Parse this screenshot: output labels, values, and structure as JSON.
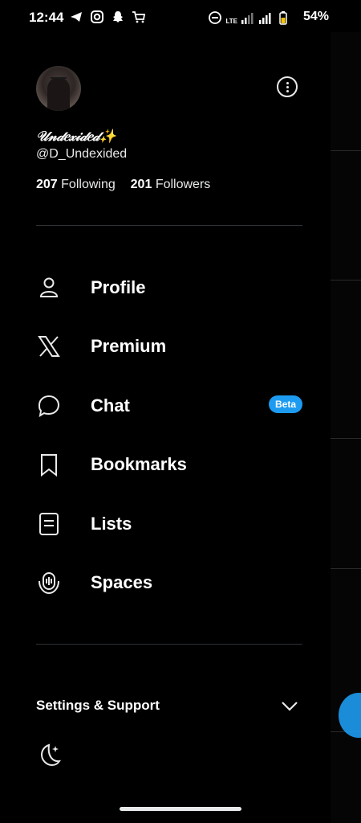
{
  "status_bar": {
    "time": "12:44",
    "battery": "54%",
    "network": "LTE",
    "icons": [
      "telegram-icon",
      "instagram-icon",
      "snapchat-icon",
      "shopping-cart-icon",
      "do-not-disturb-icon",
      "signal-icon",
      "battery-icon"
    ]
  },
  "profile": {
    "display_name": "𝒰𝓃𝒹𝑒𝓍𝒾𝒹𝑒𝒹✨",
    "handle": "@D_Undexided",
    "following_count": "207",
    "following_label": "Following",
    "followers_count": "201",
    "followers_label": "Followers"
  },
  "nav": {
    "items": [
      {
        "label": "Profile",
        "icon": "person-icon"
      },
      {
        "label": "Premium",
        "icon": "x-logo-icon"
      },
      {
        "label": "Chat",
        "icon": "chat-bubble-icon",
        "badge": "Beta"
      },
      {
        "label": "Bookmarks",
        "icon": "bookmark-icon"
      },
      {
        "label": "Lists",
        "icon": "list-icon"
      },
      {
        "label": "Spaces",
        "icon": "microphone-icon"
      }
    ]
  },
  "settings": {
    "label": "Settings & Support"
  },
  "colors": {
    "background": "#000000",
    "text": "#e7e9ea",
    "accent": "#1d9bf0",
    "divider": "#2f3336"
  }
}
